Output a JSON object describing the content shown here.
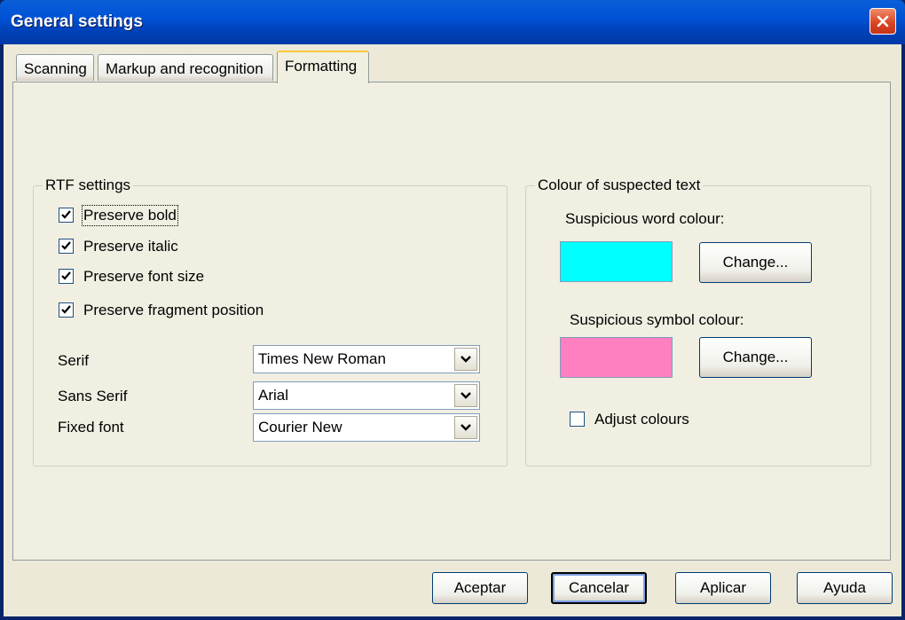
{
  "window": {
    "title": "General settings"
  },
  "tabs": [
    {
      "label": "Scanning",
      "active": false
    },
    {
      "label": "Markup and recognition",
      "active": false
    },
    {
      "label": "Formatting",
      "active": true
    }
  ],
  "rtf": {
    "legend": "RTF settings",
    "checkboxes": [
      {
        "label": "Preserve bold",
        "checked": true
      },
      {
        "label": "Preserve italic",
        "checked": true
      },
      {
        "label": "Preserve font size",
        "checked": true
      },
      {
        "label": "Preserve fragment position",
        "checked": true
      }
    ],
    "fonts": [
      {
        "label": "Serif",
        "value": "Times New Roman"
      },
      {
        "label": "Sans Serif",
        "value": "Arial"
      },
      {
        "label": "Fixed font",
        "value": "Courier New"
      }
    ]
  },
  "colour": {
    "legend": "Colour of suspected text",
    "word_label": "Suspicious word colour:",
    "word_colour": "#00FFFF",
    "symbol_label": "Suspicious symbol colour:",
    "symbol_colour": "#FF80C0",
    "change_label": "Change...",
    "adjust_label": "Adjust colours",
    "adjust_checked": false
  },
  "buttons": {
    "ok": "Aceptar",
    "cancel": "Cancelar",
    "apply": "Aplicar",
    "help": "Ayuda"
  }
}
